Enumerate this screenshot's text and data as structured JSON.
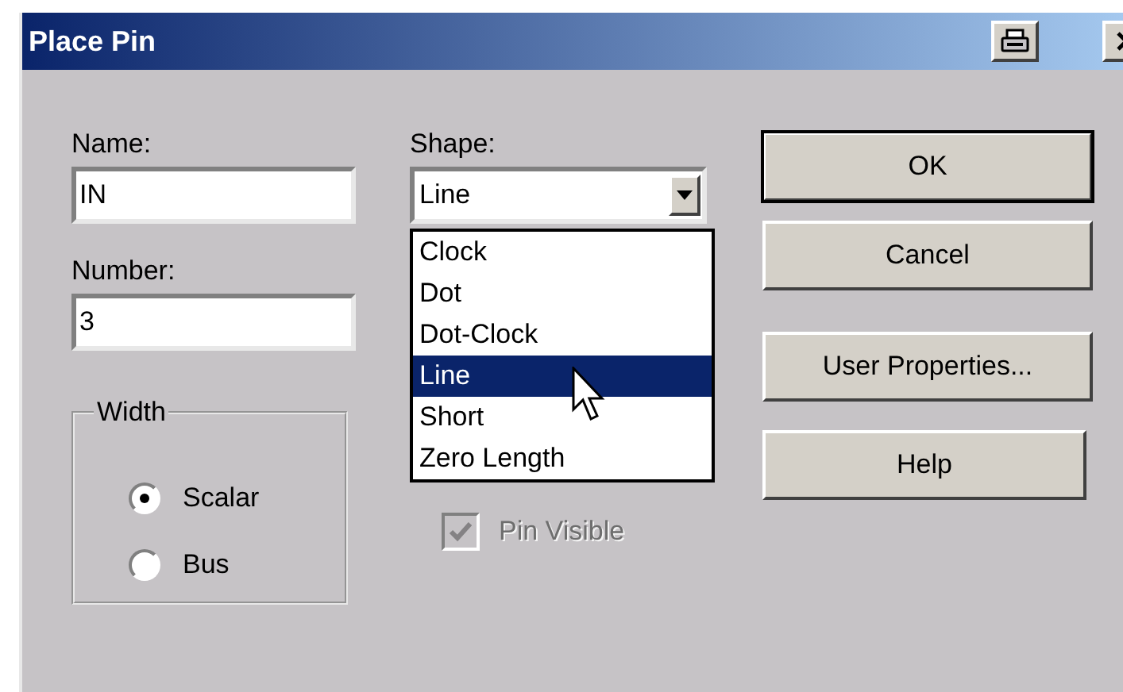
{
  "window": {
    "title": "Place Pin"
  },
  "name": {
    "label": "Name:",
    "value": "IN"
  },
  "shape": {
    "label": "Shape:",
    "value": "Line",
    "expanded": true,
    "options": [
      {
        "label": "Clock",
        "selected": false
      },
      {
        "label": "Dot",
        "selected": false
      },
      {
        "label": "Dot-Clock",
        "selected": false
      },
      {
        "label": "Line",
        "selected": true
      },
      {
        "label": "Short",
        "selected": false
      },
      {
        "label": "Zero Length",
        "selected": false
      }
    ]
  },
  "number": {
    "label": "Number:",
    "value": "3"
  },
  "width_group": {
    "label": "Width",
    "options": [
      {
        "label": "Scalar",
        "selected": true
      },
      {
        "label": "Bus",
        "selected": false
      }
    ]
  },
  "pin_visible": {
    "label": "Pin Visible",
    "checked": true,
    "disabled": true
  },
  "buttons": [
    {
      "label": "OK",
      "default": true
    },
    {
      "label": "Cancel",
      "default": false
    },
    {
      "label": "User Properties...",
      "default": false
    },
    {
      "label": "Help",
      "default": false
    }
  ]
}
